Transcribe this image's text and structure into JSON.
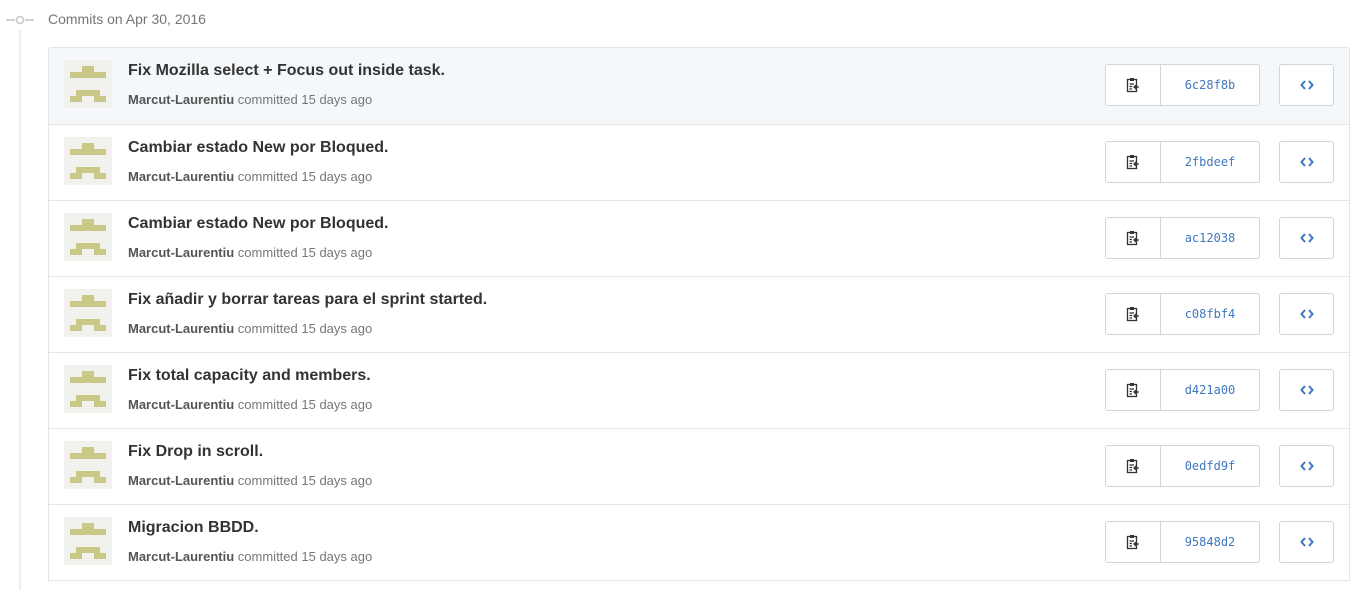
{
  "group": {
    "title": "Commits on Apr 30, 2016"
  },
  "colors": {
    "link": "#4078c0",
    "avatar_fg": "#c9c887",
    "avatar_bg": "#f1f1ed"
  },
  "commits": [
    {
      "message": "Fix Mozilla select + Focus out inside task.",
      "author": "Marcut-Laurentiu",
      "action": "committed 15 days ago",
      "sha": "6c28f8b"
    },
    {
      "message": "Cambiar estado New por Bloqued.",
      "author": "Marcut-Laurentiu",
      "action": "committed 15 days ago",
      "sha": "2fbdeef"
    },
    {
      "message": "Cambiar estado New por Bloqued.",
      "author": "Marcut-Laurentiu",
      "action": "committed 15 days ago",
      "sha": "ac12038"
    },
    {
      "message": "Fix añadir y borrar tareas para el sprint started.",
      "author": "Marcut-Laurentiu",
      "action": "committed 15 days ago",
      "sha": "c08fbf4"
    },
    {
      "message": "Fix total capacity and members.",
      "author": "Marcut-Laurentiu",
      "action": "committed 15 days ago",
      "sha": "d421a00"
    },
    {
      "message": "Fix Drop in scroll.",
      "author": "Marcut-Laurentiu",
      "action": "committed 15 days ago",
      "sha": "0edfd9f"
    },
    {
      "message": "Migracion BBDD.",
      "author": "Marcut-Laurentiu",
      "action": "committed 15 days ago",
      "sha": "95848d2"
    }
  ]
}
